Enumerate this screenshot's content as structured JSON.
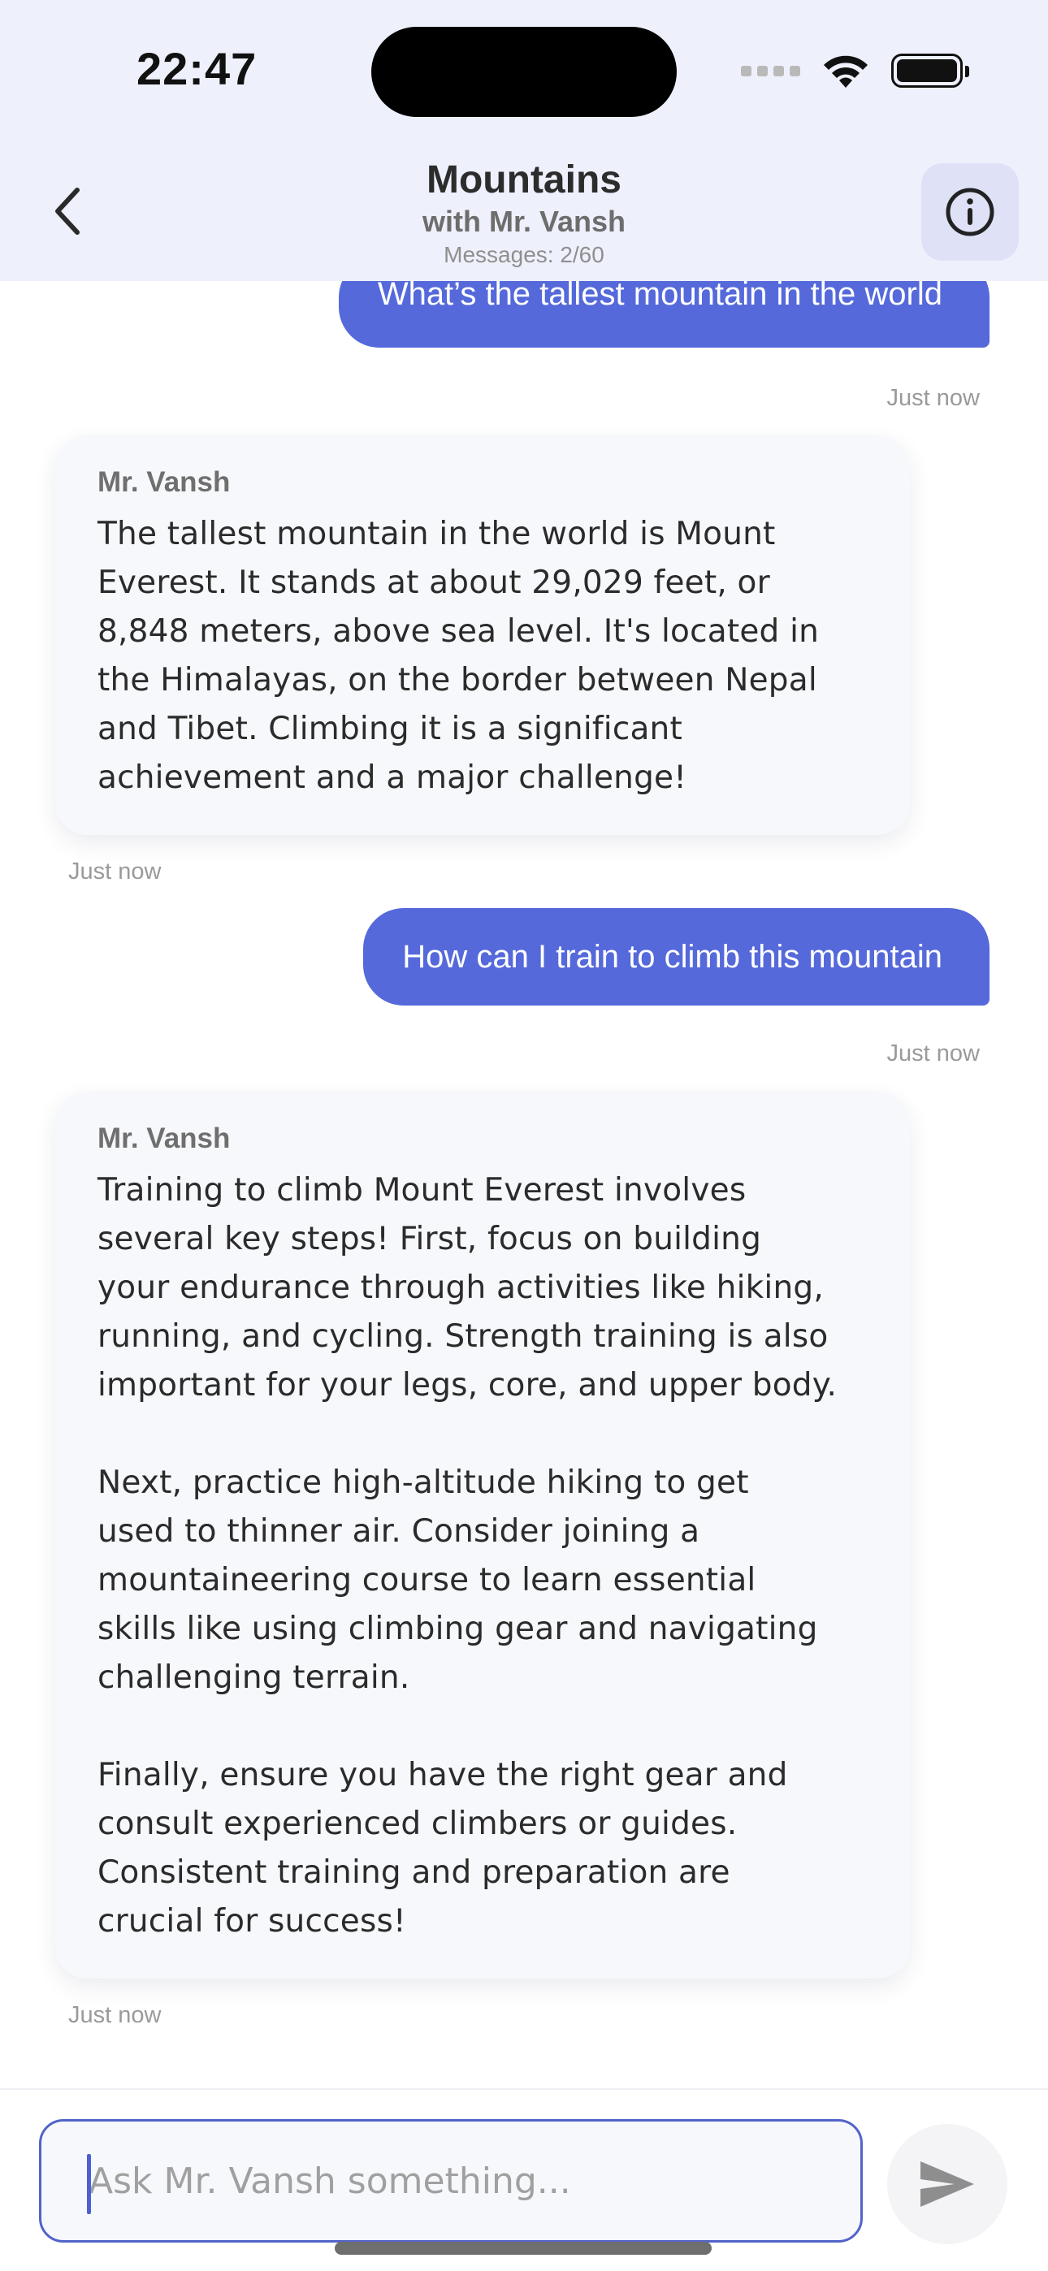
{
  "status_bar": {
    "time": "22:47"
  },
  "header": {
    "title": "Mountains",
    "subtitle": "with Mr. Vansh",
    "counter": "Messages: 2/60"
  },
  "messages": [
    {
      "role": "user",
      "text": "What’s the tallest mountain in the world",
      "timestamp": "Just now"
    },
    {
      "role": "assistant",
      "sender": "Mr. Vansh",
      "text": "The tallest mountain in the world is Mount\nEverest. It stands at about 29,029 feet, or\n8,848 meters, above sea level. It's located in\nthe Himalayas, on the border between Nepal\nand Tibet. Climbing it is a significant\nachievement and a major challenge!",
      "timestamp": "Just now"
    },
    {
      "role": "user",
      "text": "How can I train to climb this mountain",
      "timestamp": "Just now"
    },
    {
      "role": "assistant",
      "sender": "Mr. Vansh",
      "text": "Training to climb Mount Everest involves\nseveral key steps! First, focus on building\nyour endurance through activities like hiking,\nrunning, and cycling. Strength training is also\nimportant for your legs, core, and upper body.\n\nNext, practice high-altitude hiking to get\nused to thinner air. Consider joining a\nmountaineering course to learn essential\nskills like using climbing gear and navigating\nchallenging terrain.\n\nFinally, ensure you have the right gear and\nconsult experienced climbers or guides.\nConsistent training and preparation are\ncrucial for success!",
      "timestamp": "Just now"
    }
  ],
  "composer": {
    "placeholder": "Ask Mr. Vansh something...",
    "value": ""
  },
  "icons": {
    "back": "chevron-left-icon",
    "info": "info-icon",
    "send": "send-icon",
    "wifi": "wifi-icon",
    "battery": "battery-icon",
    "cellular": "cellular-signal-icon"
  },
  "colors": {
    "accent": "#5569db",
    "header_bg": "#eef0fb",
    "info_button_bg": "#dfe2f7",
    "card_bg": "#f7f8fb"
  }
}
